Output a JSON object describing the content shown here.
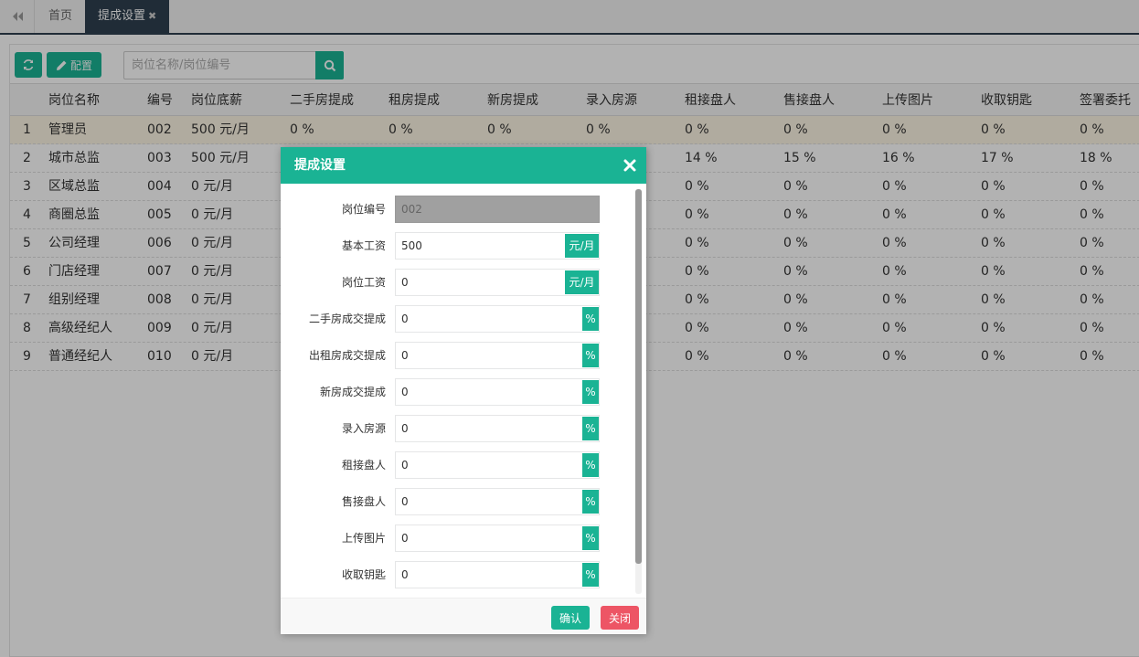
{
  "tabs": {
    "home": "首页",
    "active": "提成设置",
    "close_glyph": "✖"
  },
  "toolbar": {
    "config_label": "配置",
    "search_placeholder": "岗位名称/岗位编号"
  },
  "table": {
    "headers": [
      "岗位名称",
      "编号",
      "岗位底薪",
      "二手房提成",
      "租房提成",
      "新房提成",
      "录入房源",
      "租接盘人",
      "售接盘人",
      "上传图片",
      "收取钥匙",
      "签署委托"
    ],
    "rows": [
      {
        "index": "1",
        "name": "管理员",
        "code": "002",
        "salary": "500 元/月",
        "c3": "0 %",
        "c4": "0 %",
        "c5": "0 %",
        "c6": "0 %",
        "c7": "0 %",
        "c8": "0 %",
        "c9": "0 %",
        "c10": "0 %",
        "c11": "0 %"
      },
      {
        "index": "2",
        "name": "城市总监",
        "code": "003",
        "salary": "500 元/月",
        "c3": "",
        "c4": "",
        "c5": "",
        "c6": "",
        "c7": "14 %",
        "c8": "15 %",
        "c9": "16 %",
        "c10": "17 %",
        "c11": "18 %"
      },
      {
        "index": "3",
        "name": "区域总监",
        "code": "004",
        "salary": "0 元/月",
        "c3": "",
        "c4": "",
        "c5": "",
        "c6": "",
        "c7": "0 %",
        "c8": "0 %",
        "c9": "0 %",
        "c10": "0 %",
        "c11": "0 %"
      },
      {
        "index": "4",
        "name": "商圈总监",
        "code": "005",
        "salary": "0 元/月",
        "c3": "",
        "c4": "",
        "c5": "",
        "c6": "",
        "c7": "0 %",
        "c8": "0 %",
        "c9": "0 %",
        "c10": "0 %",
        "c11": "0 %"
      },
      {
        "index": "5",
        "name": "公司经理",
        "code": "006",
        "salary": "0 元/月",
        "c3": "",
        "c4": "",
        "c5": "",
        "c6": "",
        "c7": "0 %",
        "c8": "0 %",
        "c9": "0 %",
        "c10": "0 %",
        "c11": "0 %"
      },
      {
        "index": "6",
        "name": "门店经理",
        "code": "007",
        "salary": "0 元/月",
        "c3": "",
        "c4": "",
        "c5": "",
        "c6": "",
        "c7": "0 %",
        "c8": "0 %",
        "c9": "0 %",
        "c10": "0 %",
        "c11": "0 %"
      },
      {
        "index": "7",
        "name": "组别经理",
        "code": "008",
        "salary": "0 元/月",
        "c3": "",
        "c4": "",
        "c5": "",
        "c6": "",
        "c7": "0 %",
        "c8": "0 %",
        "c9": "0 %",
        "c10": "0 %",
        "c11": "0 %"
      },
      {
        "index": "8",
        "name": "高级经纪人",
        "code": "009",
        "salary": "0 元/月",
        "c3": "",
        "c4": "",
        "c5": "",
        "c6": "",
        "c7": "0 %",
        "c8": "0 %",
        "c9": "0 %",
        "c10": "0 %",
        "c11": "0 %"
      },
      {
        "index": "9",
        "name": "普通经纪人",
        "code": "010",
        "salary": "0 元/月",
        "c3": "",
        "c4": "",
        "c5": "",
        "c6": "",
        "c7": "0 %",
        "c8": "0 %",
        "c9": "0 %",
        "c10": "0 %",
        "c11": "0 %"
      }
    ]
  },
  "modal": {
    "title": "提成设置",
    "confirm_label": "确认",
    "cancel_label": "关闭",
    "fields": [
      {
        "label": "岗位编号",
        "value": "002",
        "addon": ""
      },
      {
        "label": "基本工资",
        "value": "500",
        "addon": "元/月"
      },
      {
        "label": "岗位工资",
        "value": "0",
        "addon": "元/月"
      },
      {
        "label": "二手房成交提成",
        "value": "0",
        "addon": "%"
      },
      {
        "label": "出租房成交提成",
        "value": "0",
        "addon": "%"
      },
      {
        "label": "新房成交提成",
        "value": "0",
        "addon": "%"
      },
      {
        "label": "录入房源",
        "value": "0",
        "addon": "%"
      },
      {
        "label": "租接盘人",
        "value": "0",
        "addon": "%"
      },
      {
        "label": "售接盘人",
        "value": "0",
        "addon": "%"
      },
      {
        "label": "上传图片",
        "value": "0",
        "addon": "%"
      },
      {
        "label": "收取钥匙",
        "value": "0",
        "addon": "%"
      }
    ]
  },
  "colors": {
    "accent": "#1ab394",
    "danger": "#ed5565",
    "nav_dark": "#2f4050",
    "selected_row": "#fdf5e4"
  },
  "icons": {
    "back": "double-chevron-left-icon",
    "refresh": "refresh-icon",
    "config": "pencil-icon",
    "search": "search-icon",
    "close": "close-icon"
  }
}
